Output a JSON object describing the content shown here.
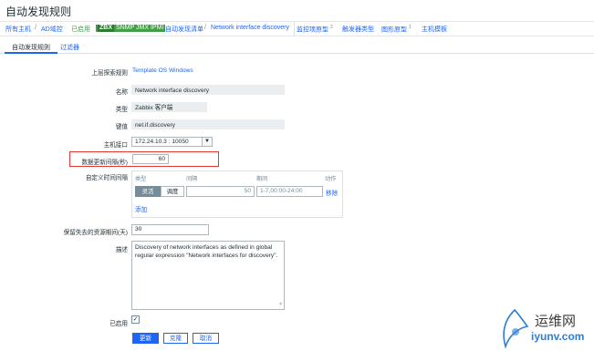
{
  "page_title": "自动发现规则",
  "topnav": {
    "all_hosts": "所有主机",
    "sep1": "/",
    "host": "AD域控",
    "status": "已启用",
    "badges": [
      "ZBX",
      "SNMP",
      "JMX",
      "IPMI"
    ],
    "discovery_list": "自动发现清单",
    "sep2": "/",
    "current_rule": "Network interface discovery",
    "item_prototypes": "监控项原型",
    "item_prototypes_count": "2",
    "trigger_prototypes": "触发器类型",
    "graph_prototypes": "图形原型",
    "graph_prototypes_count": "1",
    "host_prototypes": "主机模板"
  },
  "tabs": {
    "discovery_rule": "自动发现规则",
    "filters": "过滤器"
  },
  "form": {
    "parent_label": "上层探索规则",
    "parent_value": "Template OS Windows",
    "name_label": "名称",
    "name_value": "Network interface discovery",
    "type_label": "类型",
    "type_value": "Zabbix 客户端",
    "key_label": "键值",
    "key_value": "net.if.discovery",
    "interface_label": "主机接口",
    "interface_value": "172.24.10.3 : 10050",
    "interval_label": "数据更新间隔(秒)",
    "interval_value": "60",
    "custom_intervals_label": "自定义时间间隔",
    "custom_intervals": {
      "col_type": "类型",
      "col_interval": "间隔",
      "col_period": "期间",
      "col_action": "动作",
      "flexible": "灵活",
      "scheduling": "调度",
      "interval_value": "50",
      "period_value": "1-7,00:00-24:00",
      "remove": "移除",
      "add": "添加"
    },
    "keep_lost_label": "保留失去的资源期间(天)",
    "keep_lost_value": "30",
    "description_label": "描述",
    "description_value": "Discovery of network interfaces as defined in global regular expression \"Network interfaces for discovery\".",
    "enabled_label": "已启用",
    "enabled": true
  },
  "buttons": {
    "update": "更新",
    "clone": "克隆",
    "cancel": "取消"
  },
  "watermark": {
    "cn": "运维网",
    "url": "iyunv.com"
  },
  "colors": {
    "link": "#1f65f4",
    "enabled_green": "#429e47",
    "highlight_red": "#e33734"
  }
}
